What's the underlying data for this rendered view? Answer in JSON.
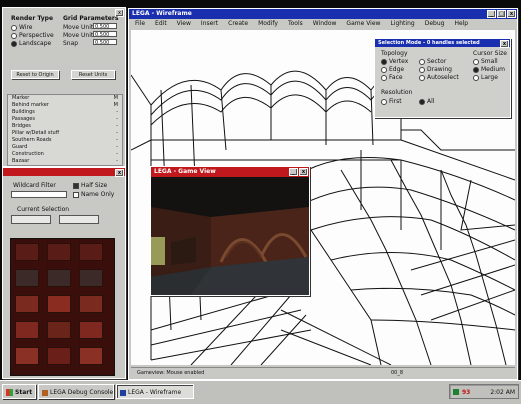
{
  "left_panel": {
    "render_type": {
      "heading": "Render Type",
      "options": [
        "Wire",
        "Perspective",
        "Landscape"
      ],
      "selected": 2
    },
    "grid_params": {
      "heading": "Grid Parameters",
      "rows": [
        {
          "label": "Move Units",
          "value": "0.500"
        },
        {
          "label": "Move Units",
          "value": "0.500"
        },
        {
          "label": "Snap",
          "value": "0.500"
        }
      ]
    },
    "buttons": {
      "reset_origin": "Reset to Origin",
      "reset_units": "Reset Units"
    },
    "layers": {
      "items": [
        "Marker",
        "Behind marker",
        "Buildings",
        "Passages",
        "Bridges",
        "Pillar w/Detail stuff",
        "Southern Roads",
        "Guard",
        "Construction",
        "Bazaar"
      ],
      "flags": [
        "M",
        "M",
        "-",
        "-",
        "-",
        "-",
        "-",
        "-",
        "-",
        "-"
      ]
    }
  },
  "texture_panel": {
    "title": "",
    "wildcard_label": "Wildcard Filter",
    "half_size": "Half Size",
    "name_only": "Name Only",
    "current_selection": "Current Selection"
  },
  "main_window": {
    "title": "LEGA - Wireframe",
    "menu": [
      "File",
      "Edit",
      "View",
      "Insert",
      "Create",
      "Modify",
      "Tools",
      "Window",
      "Game View",
      "Lighting",
      "Debug",
      "Help"
    ],
    "status_left": "Gameview: Mouse enabled",
    "status_right": "00_8"
  },
  "selection_panel": {
    "title": "Selection Mode - 0 handles selected",
    "topology_label": "Topology",
    "topology_options": [
      "Vertex",
      "Edge",
      "Face",
      "Sector",
      "Drawing",
      "Autoselect"
    ],
    "topology_selected": 0,
    "cursor_size_label": "Cursor Size",
    "cursor_options": [
      "Small",
      "Medium",
      "Large"
    ],
    "cursor_selected": 1,
    "resolution_label": "Resolution",
    "resolution_options": [
      "First",
      "All"
    ],
    "resolution_selected": 1
  },
  "game_view": {
    "title": "LEGA - Game View"
  },
  "taskbar": {
    "start": "Start",
    "items": [
      "LEGA Debug Console",
      "LEGA - Wireframe"
    ],
    "clock": "2:02 AM",
    "tray_number": "93"
  }
}
